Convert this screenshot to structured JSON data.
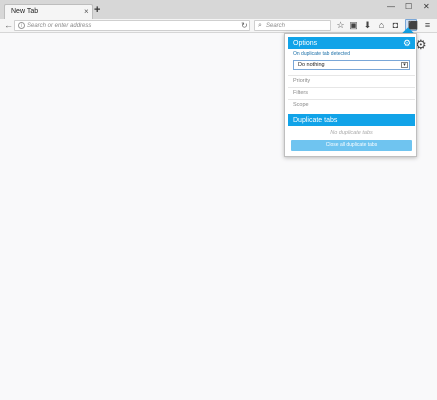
{
  "browser": {
    "tab_title": "New Tab",
    "tab_close": "×",
    "new_tab": "+",
    "url_placeholder": "Search or enter address",
    "search_placeholder": "Search"
  },
  "popup": {
    "options_title": "Options",
    "detect_label": "On duplicate tab detected",
    "select_value": "Do nothing",
    "menu_items": [
      "Priority",
      "Filters",
      "Scope"
    ],
    "duplicates_title": "Duplicate tabs",
    "empty_text": "No duplicate tabs",
    "close_all_label": "Close all duplicate tabs"
  },
  "colors": {
    "accent": "#11a3e8",
    "button": "#6fc4f0"
  },
  "icons": [
    "back-icon",
    "info-icon",
    "reload-icon",
    "search-icon",
    "star-icon",
    "clipboard-icon",
    "download-icon",
    "home-icon",
    "pocket-icon",
    "extension-icon",
    "menu-icon",
    "gear-icon"
  ]
}
